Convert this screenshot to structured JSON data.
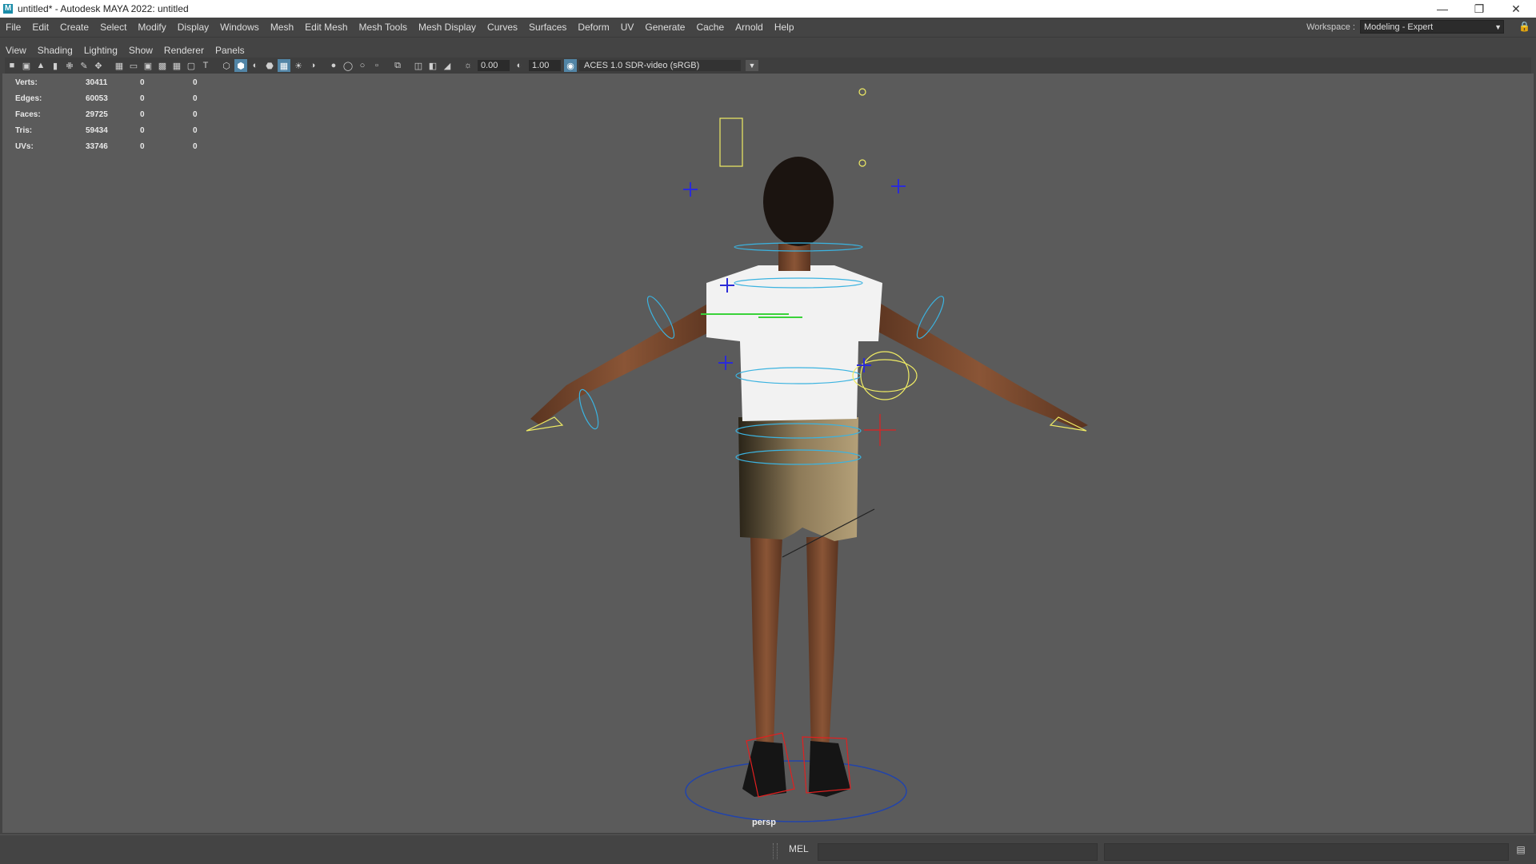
{
  "window": {
    "title": "untitled* - Autodesk MAYA 2022: untitled",
    "app_icon": "M",
    "controls": [
      "minimize-icon",
      "restore-icon",
      "close-icon"
    ]
  },
  "menubar": {
    "items": [
      "File",
      "Edit",
      "Create",
      "Select",
      "Modify",
      "Display",
      "Windows",
      "Mesh",
      "Edit Mesh",
      "Mesh Tools",
      "Mesh Display",
      "Curves",
      "Surfaces",
      "Deform",
      "UV",
      "Generate",
      "Cache",
      "Arnold",
      "Help"
    ]
  },
  "workspace": {
    "label": "Workspace :",
    "value": "Modeling - Expert"
  },
  "panel_menu": {
    "items": [
      "View",
      "Shading",
      "Lighting",
      "Show",
      "Renderer",
      "Panels"
    ]
  },
  "panel_toolbar": {
    "exposure": "0.00",
    "gamma": "1.00",
    "color_space": "ACES 1.0 SDR-video (sRGB)"
  },
  "hud": {
    "rows": [
      {
        "label": "Verts:",
        "v1": "30411",
        "v2": "0",
        "v3": "0"
      },
      {
        "label": "Edges:",
        "v1": "60053",
        "v2": "0",
        "v3": "0"
      },
      {
        "label": "Faces:",
        "v1": "29725",
        "v2": "0",
        "v3": "0"
      },
      {
        "label": "Tris:",
        "v1": "59434",
        "v2": "0",
        "v3": "0"
      },
      {
        "label": "UVs:",
        "v1": "33746",
        "v2": "0",
        "v3": "0"
      }
    ]
  },
  "viewport": {
    "camera": "persp",
    "background": "#5b5b5b"
  },
  "statusbar": {
    "mel_label": "MEL"
  },
  "colors": {
    "accent": "#5285a6",
    "rig_blue": "#3bb3e0",
    "rig_yellow": "#f0ec64",
    "rig_red": "#e02020",
    "rig_green": "#3ad23a"
  }
}
